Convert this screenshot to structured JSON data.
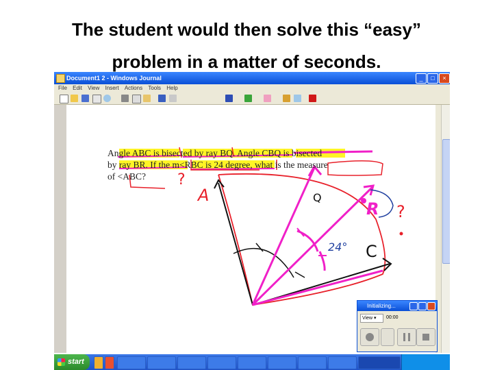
{
  "slide": {
    "title_line1": "The student would then solve this “easy”",
    "title_line2": "problem in a matter of seconds."
  },
  "window": {
    "title": "Document1 2 - Windows Journal",
    "menu": [
      "File",
      "Edit",
      "View",
      "Insert",
      "Actions",
      "Tools",
      "Help"
    ]
  },
  "question": {
    "line1": "Angle ABC is bisected by ray BQ. Angle CBQ is bisected",
    "line2": "by ray BR. If the m<RBC is 24 degree, what is the measure",
    "line3": "of <ABC?"
  },
  "handwriting": {
    "label_a": "A",
    "label_q": "Q",
    "label_r": "R",
    "label_c": "C",
    "angle": "24°",
    "question_mark_1": "?",
    "question_mark_2": "?"
  },
  "recorder": {
    "title": "Initializing...",
    "view_label": "View",
    "time": "00:00"
  },
  "taskbar": {
    "start_label": "start"
  },
  "colors": {
    "highlight": "#fff200",
    "pink_ink": "#f020c8",
    "red_ink": "#e8202a",
    "black_ink": "#111111",
    "blue_ink": "#2040a0",
    "taskbar": "#245edb"
  }
}
